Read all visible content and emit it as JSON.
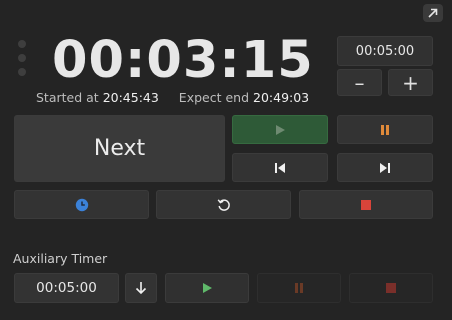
{
  "main_timer": {
    "display": "00:03:15",
    "started_label": "Started at",
    "started_value": "20:45:43",
    "expect_label": "Expect end",
    "expect_value": "20:49:03"
  },
  "duration": {
    "value": "00:05:00",
    "minus": "–",
    "plus": "+"
  },
  "controls": {
    "next_label": "Next"
  },
  "auxiliary": {
    "label": "Auxiliary Timer",
    "value": "00:05:00"
  },
  "icons": {
    "corner": "external-link-icon",
    "play": "play-icon",
    "pause": "pause-icon",
    "previous": "skip-previous-icon",
    "next": "skip-next-icon",
    "clock": "clock-icon",
    "reset": "reset-icon",
    "stop": "stop-icon",
    "down": "arrow-down-icon"
  },
  "colors": {
    "play_active": "#6fbf73",
    "pause_accent": "#e08a3a",
    "stop_red": "#d9443a",
    "clock_blue": "#3b82d9",
    "aux_stop_dim": "#7a2f2a",
    "aux_pause_dim": "#6a3a26"
  }
}
